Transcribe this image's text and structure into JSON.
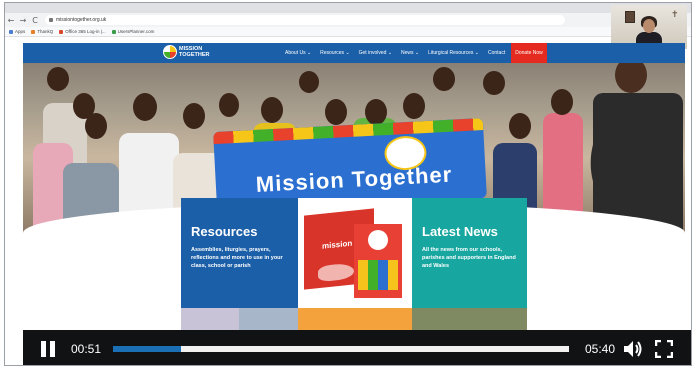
{
  "browser": {
    "url": "missiontogether.org.uk",
    "nav_back": "←",
    "nav_forward": "→",
    "nav_reload": "C",
    "bookmarks": [
      {
        "label": "Apps",
        "color": "#4f7cd1"
      },
      {
        "label": "ThankQ",
        "color": "#e57f2a"
      },
      {
        "label": "Office 365 Log-in |...",
        "color": "#d94a2b"
      },
      {
        "label": "UsersPlanner.com",
        "color": "#3a9d4b"
      }
    ]
  },
  "site": {
    "logo_text": "MISSION TOGETHER",
    "nav": [
      "About Us ⌄",
      "Resources ⌄",
      "Get involved ⌄",
      "News ⌄",
      "Liturgical Resources ⌄",
      "Contact"
    ],
    "donate_label": "Donate Now",
    "banner_text": "Mission Together",
    "resources_card": {
      "title": "Resources",
      "description": "Assemblies, liturgies, prayers, reflections and more to use in your class, school or parish"
    },
    "news_card": {
      "title": "Latest News",
      "description": "All the news from our schools, parishes and supporters in England and Wales"
    },
    "box_label": "mission"
  },
  "video": {
    "elapsed": "00:51",
    "total": "05:40",
    "progress_fraction": 0.15,
    "pause_icon": "pause-icon",
    "volume_icon": "volume-icon",
    "fullscreen_icon": "fullscreen-icon"
  },
  "colors": {
    "header_blue": "#1b5fa8",
    "donate_red": "#e52b20",
    "news_teal": "#17a6a0",
    "progress_blue": "#1a6fb5"
  }
}
